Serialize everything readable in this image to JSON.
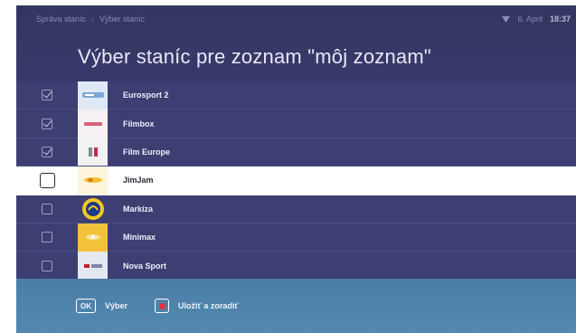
{
  "breadcrumb": [
    "Správa staníc",
    "Výber staníc"
  ],
  "breadcrumb_separator": "›",
  "status": {
    "date": "6. April",
    "time": "18:37",
    "icon": "wifi-icon"
  },
  "title": "Výber staníc pre zoznam \"môj zoznam\"",
  "channels": [
    {
      "name": "Eurosport 2",
      "checked": true,
      "logo_text": "",
      "logo_bg": "#dfe9f5",
      "logo_fg": "#3a6fb0",
      "icon": "eurosport2-logo"
    },
    {
      "name": "Filmbox",
      "checked": true,
      "logo_text": "",
      "logo_bg": "#f6f0f2",
      "logo_fg": "#d02c4c",
      "icon": "filmbox-logo"
    },
    {
      "name": "Film Europe",
      "checked": true,
      "logo_text": "",
      "logo_bg": "#f0f0f0",
      "logo_fg": "#444444",
      "icon": "filmeurope-logo"
    },
    {
      "name": "JimJam",
      "checked": false,
      "selected": true,
      "logo_text": "",
      "logo_bg": "#fdf6dc",
      "logo_fg": "#e0a010",
      "icon": "jimjam-logo"
    },
    {
      "name": "Markíza",
      "checked": false,
      "logo_text": "",
      "logo_bg": "#1a3a8a",
      "logo_fg": "#f2c81c",
      "icon": "markiza-logo"
    },
    {
      "name": "Minimax",
      "checked": false,
      "logo_text": "",
      "logo_bg": "#f3c23a",
      "logo_fg": "#ffffff",
      "icon": "minimax-logo"
    },
    {
      "name": "Nova Sport",
      "checked": false,
      "logo_text": "",
      "logo_bg": "#e4e8f0",
      "logo_fg": "#c0202c",
      "icon": "novasport-logo"
    }
  ],
  "footer": {
    "ok_key": "OK",
    "ok_label": "Výber",
    "red_label": "Uložiť a zoradiť"
  },
  "colors": {
    "background": "#3b3c6e",
    "selected_row": "#ffffff",
    "footer": "#5288b1",
    "red_key": "#e8303c"
  }
}
